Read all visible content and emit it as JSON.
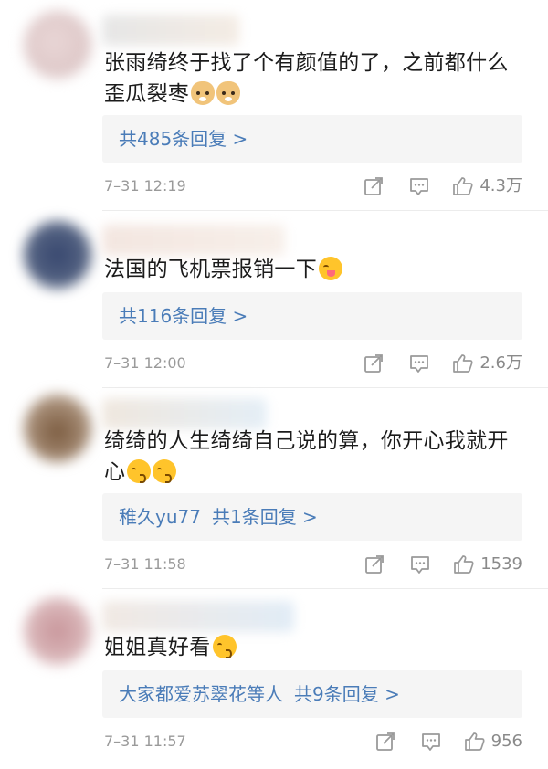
{
  "comments": [
    {
      "text": "张雨绮终于找了个有颜值的了，之前都什么歪瓜裂枣",
      "emojis": [
        "doge-emoji",
        "doge-emoji"
      ],
      "reply_prefix": "",
      "reply_label": "共485条回复 >",
      "time": "7–31 12:19",
      "likes": "4.3万"
    },
    {
      "text": "法国的飞机票报销一下",
      "emojis": [
        "yum-emoji"
      ],
      "reply_prefix": "",
      "reply_label": "共116条回复 >",
      "time": "7–31 12:00",
      "likes": "2.6万"
    },
    {
      "text": "绮绮的人生绮绮自己说的算，你开心我就开心",
      "emojis": [
        "kiss-emoji",
        "kiss-emoji"
      ],
      "reply_prefix": "稚久yu77",
      "reply_label": "共1条回复 >",
      "time": "7–31 11:58",
      "likes": "1539"
    },
    {
      "text": "姐姐真好看",
      "emojis": [
        "kiss-emoji"
      ],
      "reply_prefix": "大家都爱苏翠花等人",
      "reply_label": "共9条回复 >",
      "time": "7–31 11:57",
      "likes": "956"
    }
  ],
  "icons": {
    "repost": "share-icon",
    "comment": "comment-icon",
    "like": "thumbs-up-icon"
  },
  "colors": {
    "link": "#4a7cb8",
    "meta": "#9a9a9a",
    "reply_bg": "#f5f5f5"
  }
}
